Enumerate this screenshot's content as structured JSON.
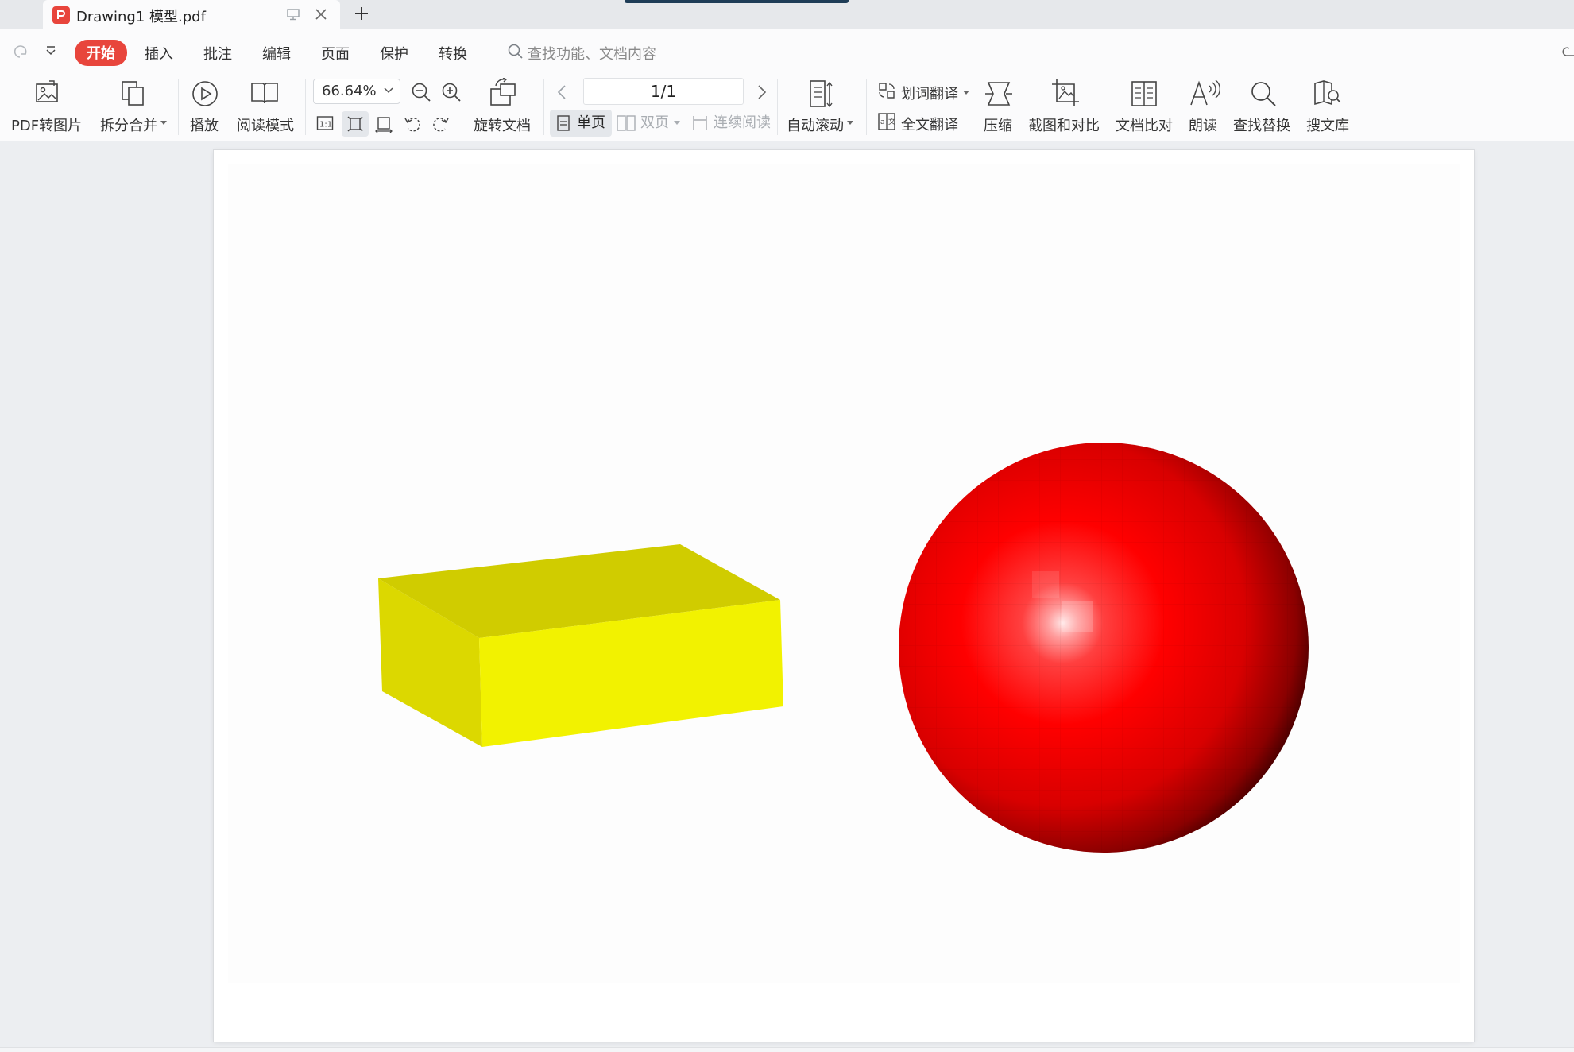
{
  "tab": {
    "title": "Drawing1 模型.pdf",
    "new_tab": "+"
  },
  "menu": {
    "items": [
      "开始",
      "插入",
      "批注",
      "编辑",
      "页面",
      "保护",
      "转换"
    ],
    "active": "开始",
    "search_placeholder": "查找功能、文档内容"
  },
  "ribbon": {
    "pdf_to_image": "PDF转图片",
    "split_merge": "拆分合并",
    "play": "播放",
    "read_mode": "阅读模式",
    "zoom": "66.64%",
    "rotate_doc": "旋转文档",
    "page_indicator": "1/1",
    "single_page": "单页",
    "double_page": "双页",
    "continuous": "连续阅读",
    "auto_scroll": "自动滚动",
    "word_translate": "划词翻译",
    "full_translate": "全文翻译",
    "compress": "压缩",
    "screenshot_compare": "截图和对比",
    "doc_compare": "文档比对",
    "read_aloud": "朗读",
    "find_replace": "查找替换",
    "search_library": "搜文库"
  },
  "colors": {
    "accent": "#e8453c",
    "box_top": "#d0cc00",
    "box_left": "#dcd800",
    "box_front": "#f2f200",
    "sphere": "#ff0000"
  }
}
